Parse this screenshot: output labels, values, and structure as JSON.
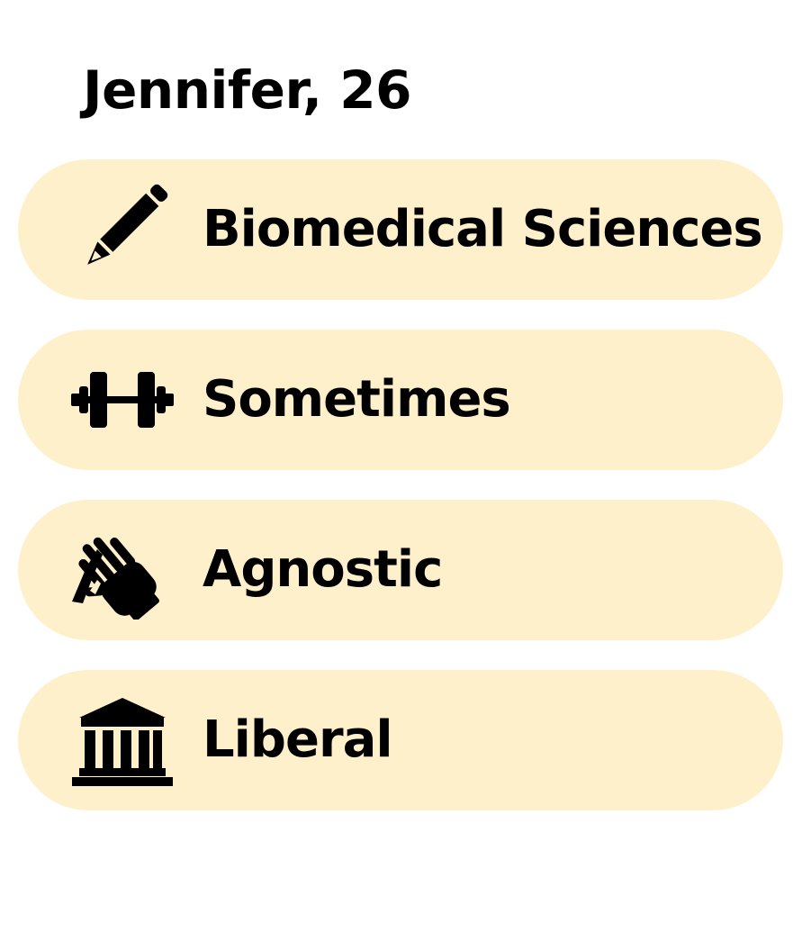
{
  "profile": {
    "name_age": "Jennifer, 26"
  },
  "attributes": [
    {
      "icon": "pencil-icon",
      "label": "Biomedical Sciences"
    },
    {
      "icon": "dumbbell-icon",
      "label": "Sometimes"
    },
    {
      "icon": "praying-hands-icon",
      "label": "Agnostic"
    },
    {
      "icon": "government-building-icon",
      "label": "Liberal"
    }
  ],
  "colors": {
    "pill_background": "#fff0cc",
    "text": "#000000"
  }
}
